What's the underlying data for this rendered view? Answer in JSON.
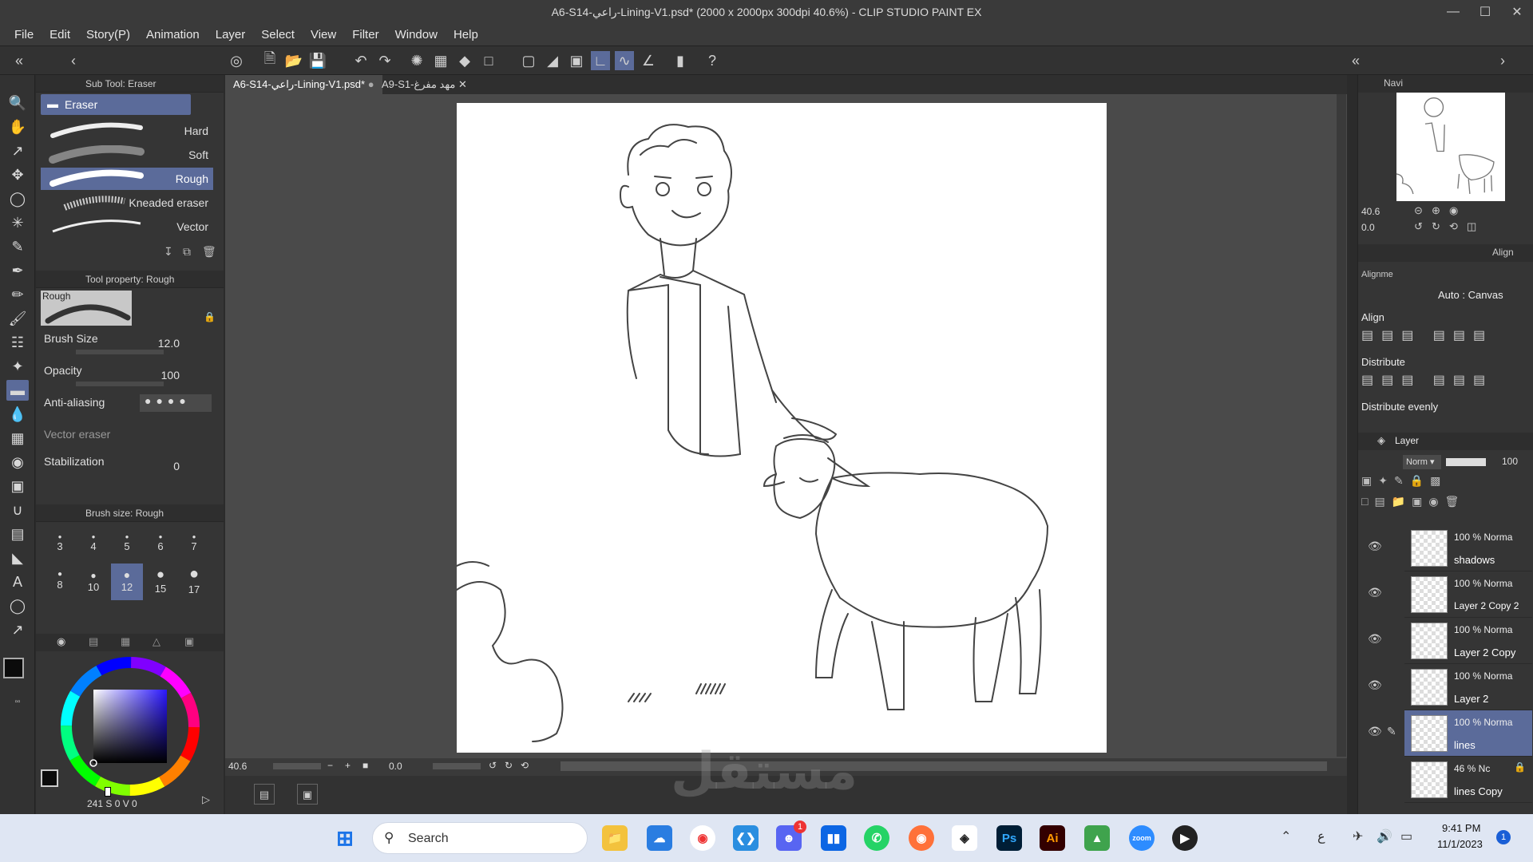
{
  "window": {
    "title": "A6-S14-راعي-Lining-V1.psd* (2000 x 2000px 300dpi 40.6%)  - CLIP STUDIO PAINT EX"
  },
  "menu": [
    "File",
    "Edit",
    "Story(P)",
    "Animation",
    "Layer",
    "Select",
    "View",
    "Filter",
    "Window",
    "Help"
  ],
  "doc_tabs": [
    {
      "label": "A6-S14-راعي-Lining-V1.psd*",
      "active": true
    },
    {
      "label": "A9-S1-مهد مفرغ",
      "active": false
    }
  ],
  "subtool": {
    "panel_title": "Sub Tool: Eraser",
    "active_tab": "Eraser",
    "brushes": [
      "Hard",
      "Soft",
      "Rough",
      "Kneaded eraser",
      "Vector"
    ],
    "selected_brush": "Rough"
  },
  "tool_property": {
    "panel_title": "Tool property: Rough",
    "preview_label": "Rough",
    "brush_size_label": "Brush Size",
    "brush_size_value": "12.0",
    "opacity_label": "Opacity",
    "opacity_value": "100",
    "anti_aliasing_label": "Anti-aliasing",
    "vector_eraser_label": "Vector eraser",
    "stabilization_label": "Stabilization",
    "stabilization_value": "0"
  },
  "brush_size_panel": {
    "title": "Brush size: Rough",
    "sizes_row1": [
      "3",
      "4",
      "5",
      "6",
      "7"
    ],
    "sizes_row2": [
      "8",
      "10",
      "12",
      "15",
      "17"
    ],
    "selected": "12"
  },
  "color": {
    "readout": "241 S 0 V 0",
    "main": "#0b0b0b",
    "sub": "#ffffff"
  },
  "canvas_status": {
    "zoom": "40.6",
    "angle": "0.0"
  },
  "navigator": {
    "title": "Navi",
    "zoom": "40.6",
    "angle": "0.0"
  },
  "align": {
    "title": "Align",
    "alignment_label": "Alignme",
    "target": "Auto : Canvas",
    "align_label": "Align",
    "distribute_label": "Distribute",
    "distribute_evenly_label": "Distribute evenly"
  },
  "layer_panel": {
    "title": "Layer",
    "blend_mode": "Norm",
    "opacity": "100",
    "layers": [
      {
        "pct": "100 % Norma",
        "name": "shadows",
        "visible": true,
        "selected": false
      },
      {
        "pct": "100 % Norma",
        "name": "Layer 2 Copy 2",
        "visible": true,
        "selected": false
      },
      {
        "pct": "100 % Norma",
        "name": "Layer 2 Copy",
        "visible": true,
        "selected": false
      },
      {
        "pct": "100 % Norma",
        "name": "Layer 2",
        "visible": true,
        "selected": false
      },
      {
        "pct": "100 % Norma",
        "name": "lines",
        "visible": true,
        "selected": true
      },
      {
        "pct": "46 % Nc",
        "name": "lines Copy",
        "visible": false,
        "selected": false
      }
    ]
  },
  "taskbar": {
    "search_placeholder": "Search",
    "time": "9:41 PM",
    "date": "11/1/2023",
    "lang": "ع",
    "notification_count": "1",
    "discord_badge": "1",
    "apps": [
      "windows-start",
      "file-explorer",
      "onedrive",
      "chrome",
      "vscode",
      "discord",
      "trello",
      "whatsapp",
      "firefox",
      "clip-studio",
      "photoshop",
      "illustrator",
      "bluestacks",
      "zoom",
      "media-player"
    ]
  },
  "watermark": "مستقل"
}
